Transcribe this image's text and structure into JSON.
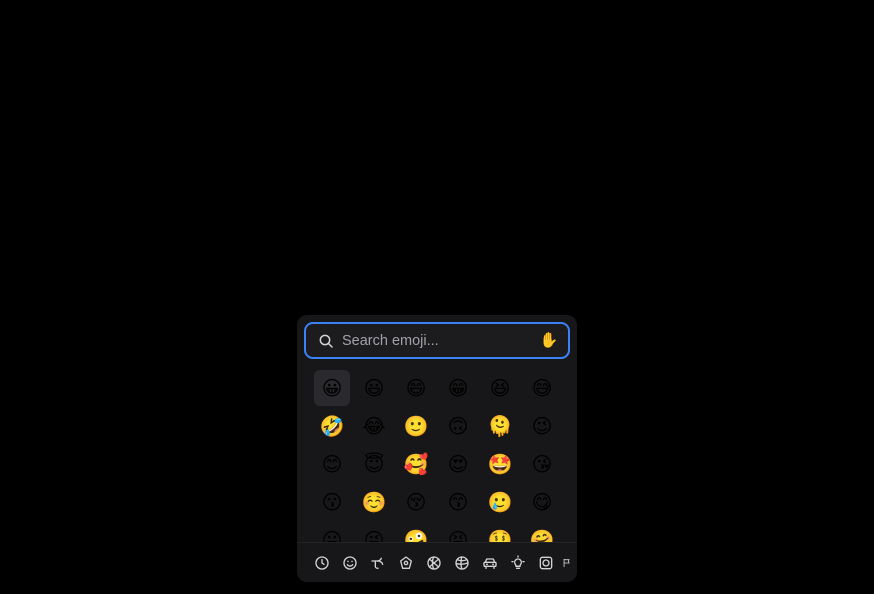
{
  "trigger": {
    "emoji": "😀"
  },
  "search": {
    "placeholder": "Search emoji...",
    "value": "",
    "skin_tone": "✋"
  },
  "grid": {
    "emojis": [
      "😀",
      "😃",
      "😄",
      "😁",
      "😆",
      "😅",
      "🤣",
      "😂",
      "🙂",
      "🙃",
      "🫠",
      "😉",
      "😊",
      "😇",
      "🥰",
      "😍",
      "🤩",
      "😘",
      "😗",
      "☺️",
      "😚",
      "😙",
      "🥲",
      "😋",
      "😛",
      "😜",
      "🤪",
      "😝",
      "🤑",
      "🤗"
    ],
    "active_index": 0
  },
  "categories": [
    {
      "name": "recent",
      "icon": "clock-icon"
    },
    {
      "name": "smileys",
      "icon": "smiley-icon"
    },
    {
      "name": "animals-nature",
      "icon": "leaf-icon"
    },
    {
      "name": "food-drink",
      "icon": "food-icon"
    },
    {
      "name": "activities",
      "icon": "ball-icon"
    },
    {
      "name": "travel-places",
      "icon": "globe-icon"
    },
    {
      "name": "objects",
      "icon": "car-icon"
    },
    {
      "name": "symbols",
      "icon": "lightbulb-icon"
    },
    {
      "name": "symbols-2",
      "icon": "symbols-icon"
    },
    {
      "name": "flags",
      "icon": "flag-icon"
    }
  ],
  "colors": {
    "background": "#000000",
    "panel": "#171719",
    "search_border": "#3b82f6",
    "icon": "#d4d4d8"
  }
}
